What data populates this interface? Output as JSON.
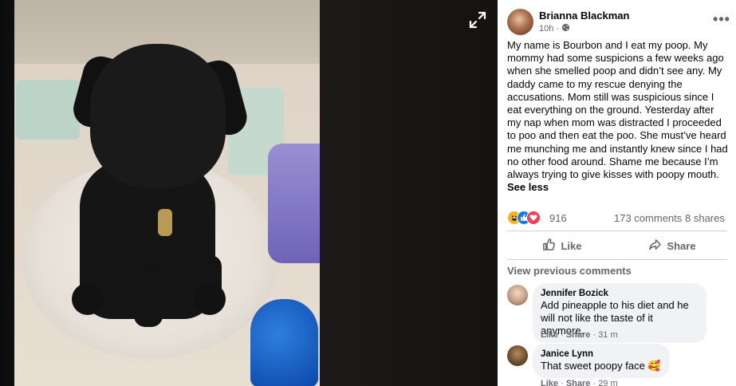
{
  "post": {
    "author": "Brianna Blackman",
    "time": "10h",
    "separator": "·",
    "text": "My name is Bourbon and I eat my poop. My mommy had some suspicions a few weeks ago when she smelled poop and didn’t see any. My daddy came to my rescue denying the accusations. Mom still was suspicious since I eat everything on the ground. Yesterday after my nap when mom was distracted I proceeded to poo and then eat the poo. She must’ve heard me munching me and instantly knew since I had no other food around. Shame me because I’m always trying to give kisses with poopy mouth.",
    "see_less": "See less",
    "more_icon": "more-horizontal-icon",
    "privacy_icon": "globe-icon"
  },
  "stats": {
    "reaction_count": "916",
    "comments": "173 comments",
    "shares": "8 shares",
    "reaction_icons": [
      "haha-reaction-icon",
      "like-reaction-icon",
      "love-reaction-icon"
    ]
  },
  "actions": {
    "like": "Like",
    "share": "Share"
  },
  "comments": {
    "view_previous": "View previous comments",
    "items": [
      {
        "name": "Jennifer Bozick",
        "text": "Add pineapple to his diet and he will not like the taste of it anymore.",
        "like": "Like",
        "reply": "Share",
        "time": "31 m"
      },
      {
        "name": "Janice Lynn",
        "text": "That sweet poopy face 🥰",
        "like": "Like",
        "reply": "Share",
        "time": "29 m"
      }
    ]
  },
  "colors": {
    "text_primary": "#050505",
    "text_secondary": "#65676b",
    "bubble_bg": "#f0f2f5",
    "like_blue": "#1877f2"
  }
}
